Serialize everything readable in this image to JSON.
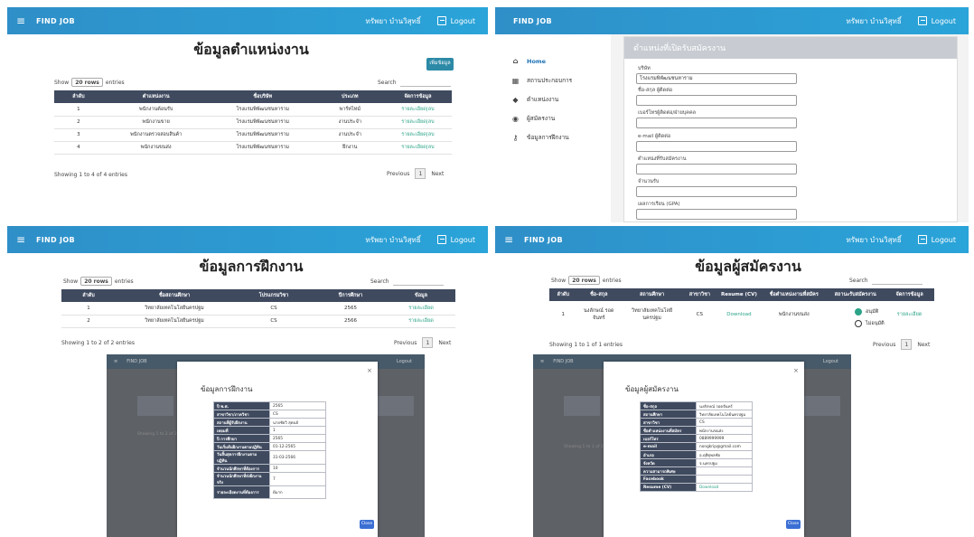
{
  "common": {
    "brand": "FIND JOB",
    "user": "ทรัพยา บำนวิสุทธิ์",
    "logout": "Logout",
    "show": "Show",
    "rows": "20 rows",
    "entries": "entries",
    "search": "Search",
    "previous": "Previous",
    "next": "Next",
    "page": "1"
  },
  "p1": {
    "title": "ข้อมูลตำแหน่งงาน",
    "add_button": "เพิ่มข้อมูล",
    "headers": [
      "ลำดับ",
      "ตำแหน่งงาน",
      "ชื่อบริษัท",
      "ประเภท",
      "จัดการข้อมูล"
    ],
    "rows": [
      [
        "1",
        "พนักงานต้อนรับ",
        "โรงแรมพิพัฒนชนหาราม",
        "พาร์ทไทม์",
        "รายละเอียด|ลบ"
      ],
      [
        "2",
        "พนักงานขาย",
        "โรงแรมพิพัฒนชนหาราม",
        "งานประจำ",
        "รายละเอียด|ลบ"
      ],
      [
        "3",
        "พนักงานตรวจสอบสินค้า",
        "โรงแรมพิพัฒนชนหาราม",
        "งานประจำ",
        "รายละเอียด|ลบ"
      ],
      [
        "4",
        "พนักงานขนส่ง",
        "โรงแรมพิพัฒนชนหาราม",
        "ฝึกงาน",
        "รายละเอียด|ลบ"
      ]
    ],
    "showing": "Showing 1 to 4 of 4 entries"
  },
  "p2": {
    "sidebar": [
      {
        "label": "Home",
        "icon": "home-icon",
        "glyph": "⌂"
      },
      {
        "label": "สถานประกอบการ",
        "icon": "building-icon",
        "glyph": "▦"
      },
      {
        "label": "ตำแหน่งงาน",
        "icon": "graduation-icon",
        "glyph": "◆"
      },
      {
        "label": "ผู้สมัครงาน",
        "icon": "eye-icon",
        "glyph": "◉"
      },
      {
        "label": "ข้อมูลการฝึกงาน",
        "icon": "key-icon",
        "glyph": "⚷"
      }
    ],
    "form_title": "ตำแหน่งที่เปิดรับสมัครงาน",
    "fields": [
      {
        "label": "บริษัท",
        "value": "โรงแรมพิพัฒนชนหาราม"
      },
      {
        "label": "ชื่อ-สกุล ผู้ติดต่อ",
        "value": ""
      },
      {
        "label": "เบอร์โทรผู้ติดต่อ/ฝ่ายบุคคล",
        "value": ""
      },
      {
        "label": "e-mail ผู้ติดต่อ",
        "value": ""
      },
      {
        "label": "ตำแหน่งที่รับสมัครงาน",
        "value": ""
      },
      {
        "label": "จำนวนรับ",
        "value": ""
      },
      {
        "label": "เผลการเรียน (GPA)",
        "value": ""
      }
    ]
  },
  "p3": {
    "title": "ข้อมูลการฝึกงาน",
    "headers": [
      "ลำดับ",
      "ชื่อสถานศึกษา",
      "โปรแกรมวิชา",
      "ปีการศึกษา",
      "ข้อมูล"
    ],
    "rows": [
      [
        "1",
        "วิทยาลัยเทคโนโลยีนครปฐม",
        "CS",
        "2565",
        "รายละเอียด"
      ],
      [
        "2",
        "วิทยาลัยเทคโนโลยีนครปฐม",
        "CS",
        "2566",
        "รายละเอียด"
      ]
    ],
    "showing": "Showing 1 to 2 of 2 entries",
    "modal_title": "ข้อมูลการฝึกงาน",
    "close": "×",
    "kv": [
      [
        "ปี พ.ศ.",
        "2565"
      ],
      [
        "สาขาวิชา/ภาควิชา",
        "CS"
      ],
      [
        "สถานที่ผู้รับฝึกงาน",
        "นายชัยวิ สุคนธ์"
      ],
      [
        "เทอมที่",
        "1"
      ],
      [
        "ปี การศึกษา",
        "2565"
      ],
      [
        "วันเริ่มต้นฝึกงานตามปฏิทิน",
        "01-12-2565"
      ],
      [
        "วันสิ้นสุดการฝึกงานตามปฏิทิน",
        "31-03-2566"
      ],
      [
        "จำนวนนักศึกษาที่ต้องการ",
        "10"
      ],
      [
        "จำนวนนักศึกษาที่ส่งฝึกงานจริง",
        "7"
      ],
      [
        "รายละเอียดงานที่ต้องการ",
        "ดีมาก"
      ]
    ],
    "button": "Close"
  },
  "p4": {
    "title": "ข้อมูลผู้สมัครงาน",
    "headers": [
      "ลำดับ",
      "ชื่อ-สกุล",
      "สถานศึกษา",
      "สาขาวิชา",
      "Resume (CV)",
      "ชื่อตำแหน่งงานที่สมัคร",
      "สถานะรับสมัครงาน",
      "จัดการข้อมูล"
    ],
    "row": [
      "1",
      "นงลักษณ์ รอดจันทร์",
      "วิทยาลัยเทคโนโลยีนครปฐม",
      "CS",
      "Download",
      "พนักงานขนส่ง",
      "",
      "รายละเอียด"
    ],
    "approve": "อนุมัติ",
    "reject": "ไม่อนุมัติ",
    "showing": "Showing 1 to 1 of 1 entries",
    "modal_title": "ข้อมูลผู้สมัครงาน",
    "close": "×",
    "kv": [
      [
        "ชื่อ-สกุล",
        "นงลักษณ์ รอดจันทร์"
      ],
      [
        "สถานศึกษา",
        "วิทยาลัยเทคโนโลยีนครปฐม"
      ],
      [
        "สาขาวิชา",
        "CS"
      ],
      [
        "ชื่อตำแหน่งงานที่สมัคร",
        "พนักงานขนส่ง"
      ],
      [
        "เบอร์โทร",
        "0889999999"
      ],
      [
        "e-mail",
        "nongkrip@gmail.com"
      ],
      [
        "อำเภอ",
        "อ.ดุสิตุพลชัย"
      ],
      [
        "จังหวัด",
        "จ.นครปฐม"
      ],
      [
        "ความสามารถพิเศษ",
        ""
      ],
      [
        "Facebook",
        ""
      ],
      [
        "Resume (CV)",
        "Download"
      ]
    ],
    "button": "Close"
  }
}
